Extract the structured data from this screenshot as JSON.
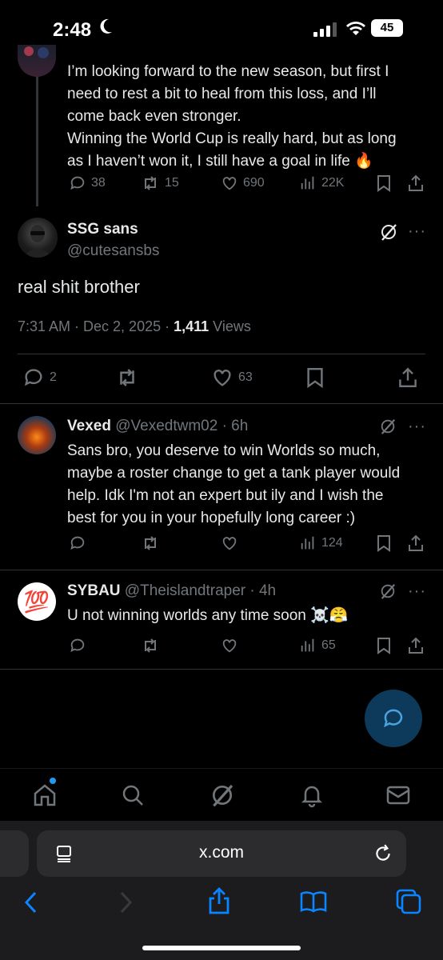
{
  "status": {
    "time": "2:48",
    "battery": "45"
  },
  "thread_tweet": {
    "lines": [
      "I’m looking forward to the new season, but first I",
      "need to rest a bit to heal from this loss, and I’ll",
      "come back even stronger.",
      "Winning the World Cup is really hard, but as long",
      "as I haven’t won it, I still have a goal in life 🔥"
    ],
    "replies": "38",
    "retweets": "15",
    "likes": "690",
    "views": "22K"
  },
  "main_tweet": {
    "name": "SSG sans",
    "handle": "@cutesansbs",
    "text": "real shit brother",
    "time": "7:31 AM · Dec 2, 2025 · ",
    "views_count": "1,411",
    "views_label": " Views",
    "replies": "2",
    "likes": "63"
  },
  "replies": [
    {
      "name": "Vexed",
      "handle": "@Vexedtwm02 · 6h",
      "lines": [
        "Sans bro, you deserve to win Worlds so much,",
        "maybe a roster change to get a tank player would",
        "help. Idk I'm not an expert but ily and I wish the",
        "best for you in your hopefully long career :)"
      ],
      "views": "124"
    },
    {
      "name": "SYBAU",
      "handle": "@Theislandtraper · 4h",
      "avatar_emoji": "💯",
      "lines": [
        "U not winning worlds any time soon ☠️😤"
      ],
      "views": "65"
    }
  ],
  "browser": {
    "url": "x.com"
  },
  "colors": {
    "accent": "#1d9bf0",
    "muted": "#71767b",
    "fab": "#0d3a5a",
    "safari_blue": "#0a84ff"
  }
}
